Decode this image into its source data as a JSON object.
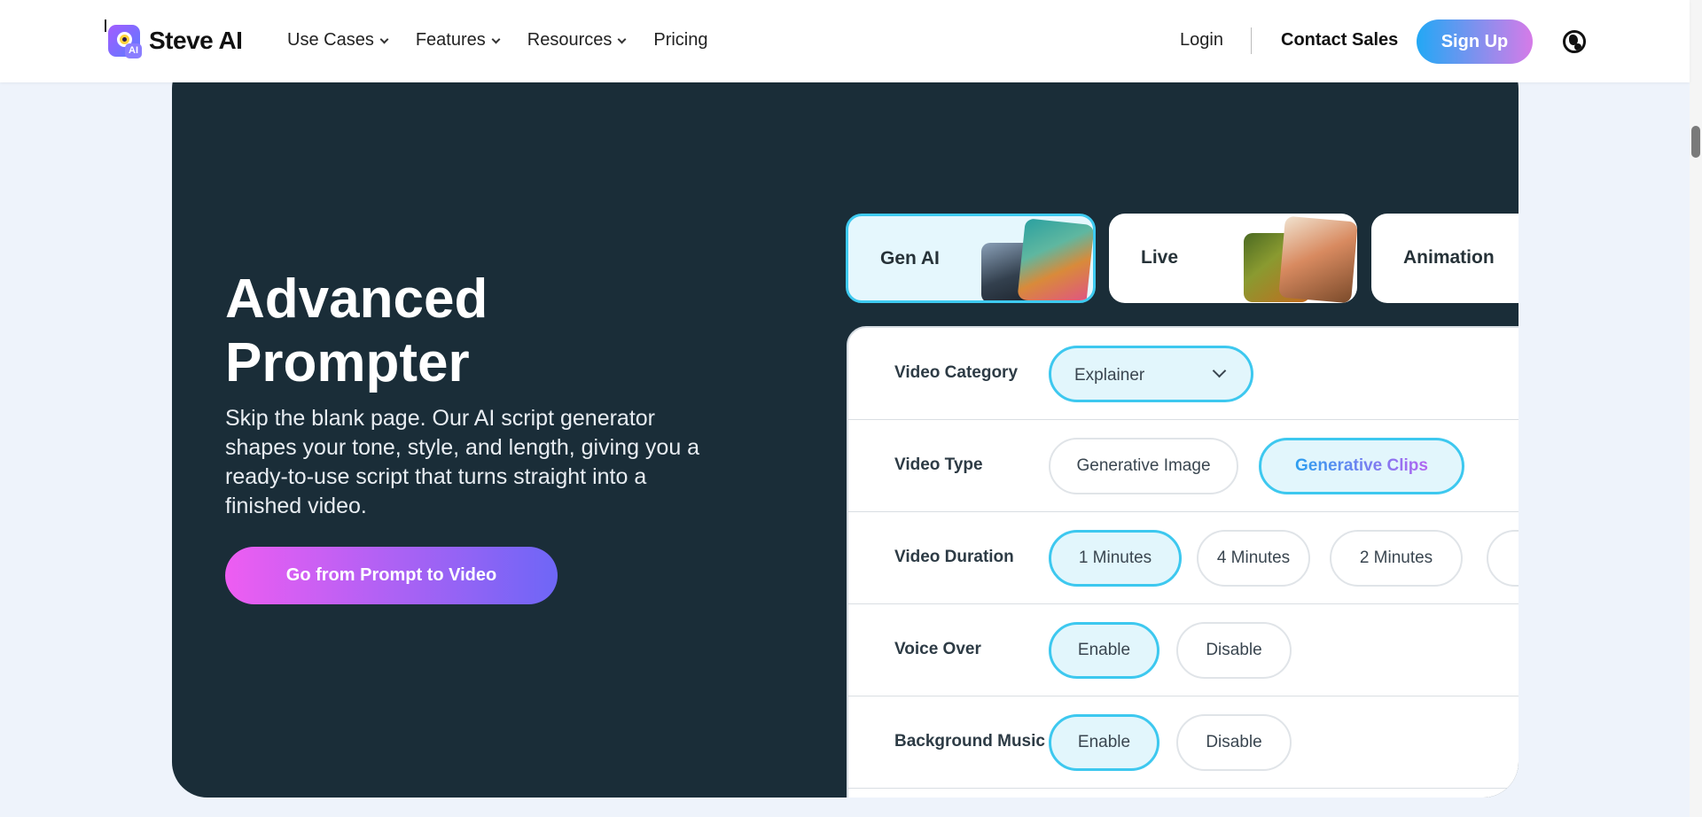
{
  "nav": {
    "logo_text": "Steve AI",
    "logo_badge": "AI",
    "menu": [
      {
        "label": "Use Cases",
        "dropdown": true
      },
      {
        "label": "Features",
        "dropdown": true
      },
      {
        "label": "Resources",
        "dropdown": true
      },
      {
        "label": "Pricing",
        "dropdown": false
      }
    ],
    "login": "Login",
    "contact": "Contact Sales",
    "signup": "Sign Up",
    "globe_icon": "globe-icon"
  },
  "hero": {
    "title": "Advanced Prompter",
    "description": "Skip the blank page. Our AI script generator shapes your tone, style, and length, giving you a ready-to-use script that turns straight into a finished video.",
    "cta": "Go from Prompt to Video"
  },
  "tabs": [
    {
      "label": "Gen AI",
      "active": true
    },
    {
      "label": "Live",
      "active": false
    },
    {
      "label": "Animation",
      "active": false
    }
  ],
  "options": {
    "video_category": {
      "label": "Video Category",
      "value": "Explainer"
    },
    "video_type": {
      "label": "Video Type",
      "options": [
        "Generative Image",
        "Generative Clips"
      ],
      "selected": "Generative Clips"
    },
    "video_duration": {
      "label": "Video Duration",
      "options": [
        "1 Minutes",
        "4 Minutes",
        "2 Minutes"
      ],
      "selected": "1 Minutes"
    },
    "voice_over": {
      "label": "Voice Over",
      "options": [
        "Enable",
        "Disable"
      ],
      "selected": "Enable"
    },
    "background_music": {
      "label": "Background Music",
      "options": [
        "Enable",
        "Disable"
      ],
      "selected": "Enable"
    }
  },
  "colors": {
    "hero_bg": "#1a2d38",
    "accent_cyan": "#3dc8ef",
    "signup_gradient": [
      "#22a8f5",
      "#d67be8"
    ],
    "cta_gradient": [
      "#ee5df2",
      "#6e66f6"
    ]
  }
}
